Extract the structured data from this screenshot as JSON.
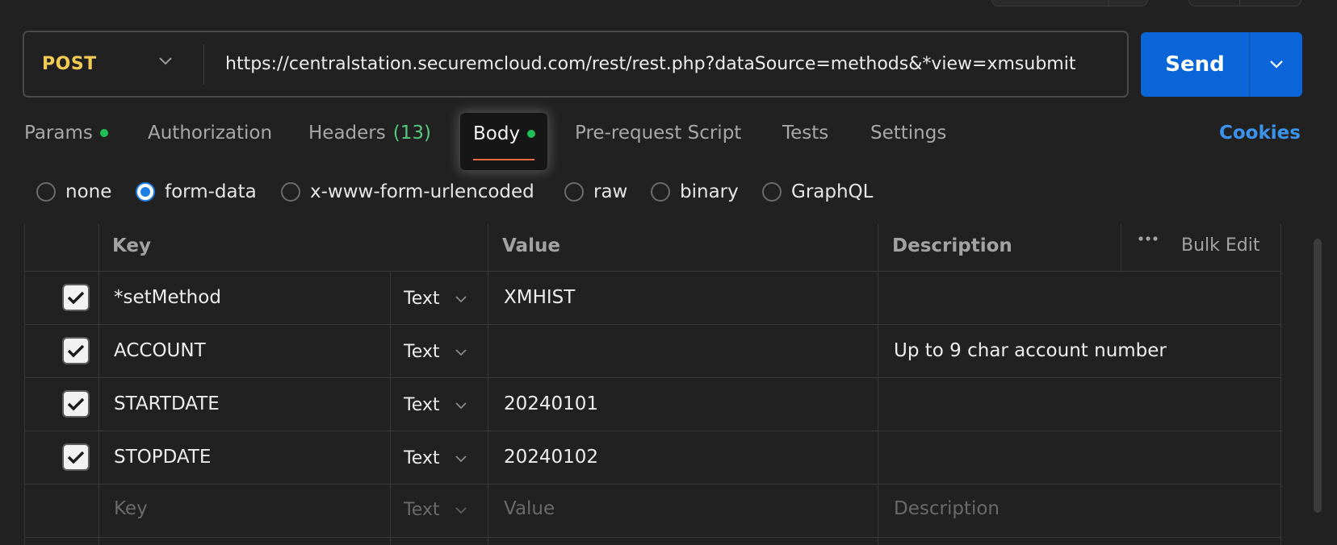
{
  "request": {
    "method": "POST",
    "url": "https://centralstation.securemcloud.com/rest/rest.php?dataSource=methods&*view=xmsubmit",
    "send_label": "Send"
  },
  "tabs": {
    "params": "Params",
    "authorization": "Authorization",
    "headers": "Headers",
    "headers_count": "(13)",
    "body": "Body",
    "prerequest": "Pre-request Script",
    "tests": "Tests",
    "settings": "Settings",
    "cookies": "Cookies"
  },
  "body_types": {
    "selected": "form-data",
    "options": [
      "none",
      "form-data",
      "x-www-form-urlencoded",
      "raw",
      "binary",
      "GraphQL"
    ]
  },
  "table": {
    "headers": {
      "key": "Key",
      "value": "Value",
      "description": "Description",
      "bulk_edit": "Bulk Edit"
    },
    "rows": [
      {
        "checked": true,
        "key": "*setMethod",
        "type": "Text",
        "value": "XMHIST",
        "description": ""
      },
      {
        "checked": true,
        "key": "ACCOUNT",
        "type": "Text",
        "value": "",
        "description": "Up to 9 char account number"
      },
      {
        "checked": true,
        "key": "STARTDATE",
        "type": "Text",
        "value": "20240101",
        "description": ""
      },
      {
        "checked": true,
        "key": "STOPDATE",
        "type": "Text",
        "value": "20240102",
        "description": ""
      }
    ],
    "placeholder": {
      "key": "Key",
      "type": "Text",
      "value": "Value",
      "description": "Description"
    }
  },
  "colors": {
    "method": "#f2cb55",
    "send": "#0a66d8",
    "active_dot": "#1fbf55",
    "tab_underline": "#f26b3a",
    "cookies_link": "#3b93ec"
  }
}
